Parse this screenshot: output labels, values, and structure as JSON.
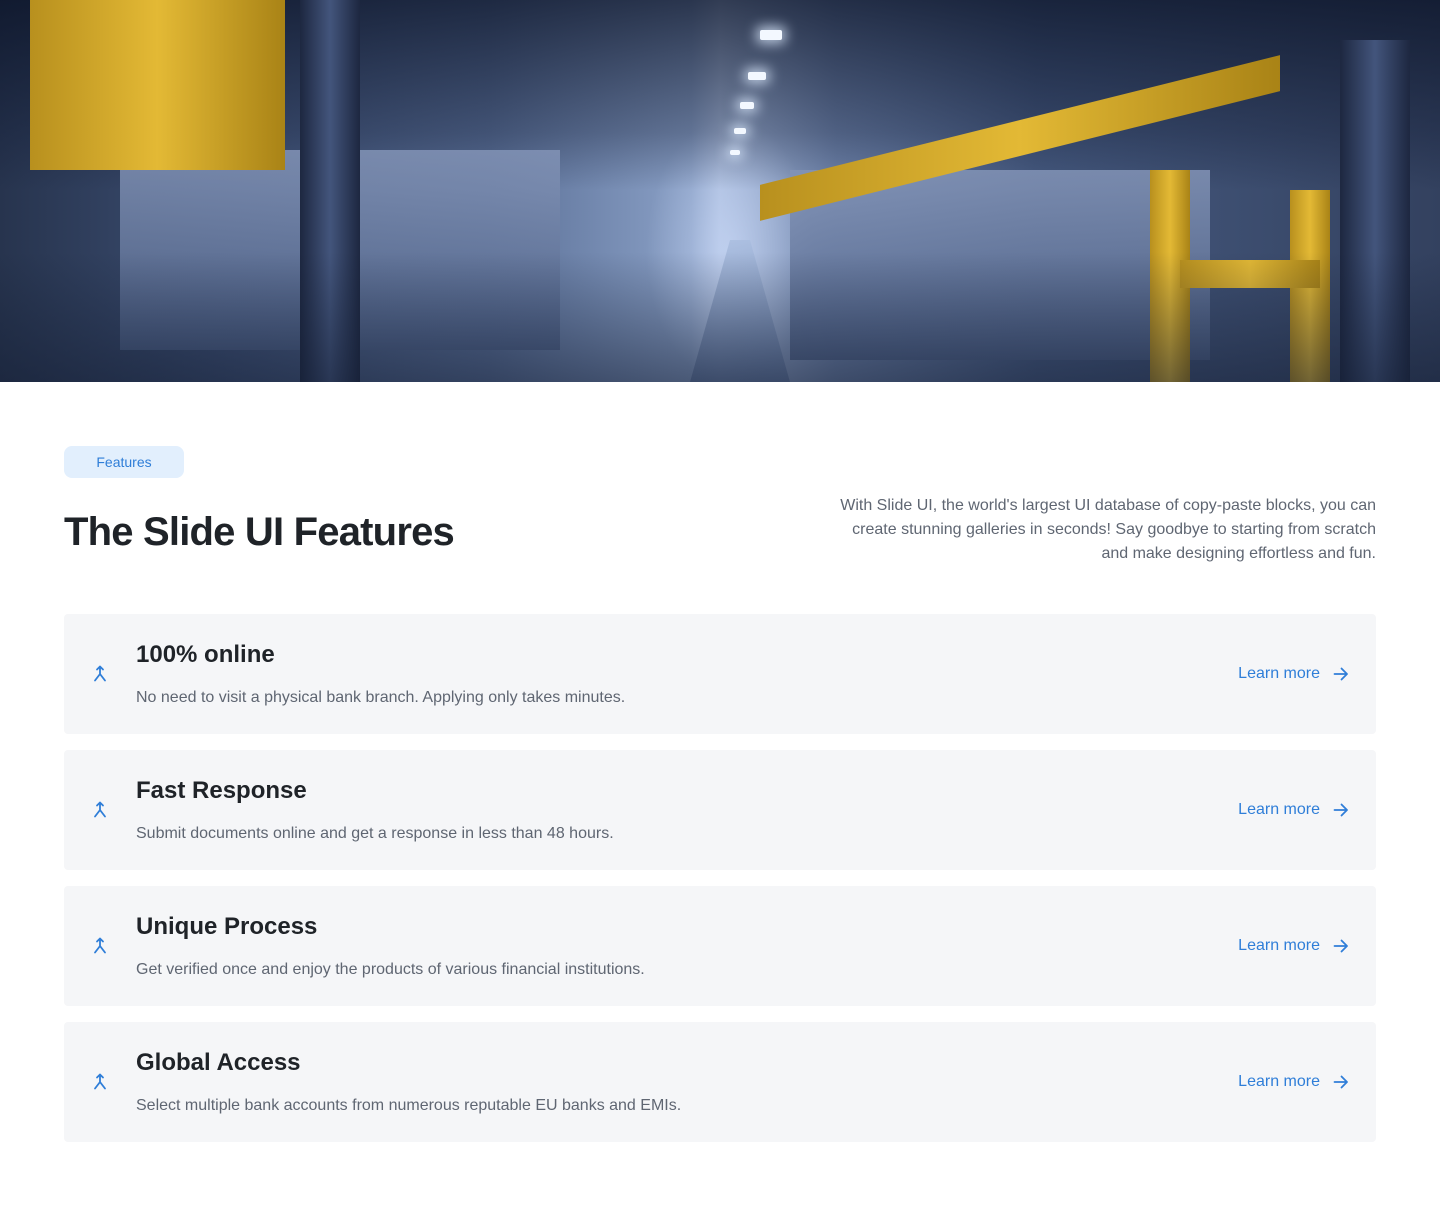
{
  "hero": {
    "image_alt": "Industrial factory production line with yellow overhead machinery"
  },
  "section": {
    "badge": "Features",
    "title": "The Slide UI Features",
    "description": "With Slide UI, the world's largest UI database of copy-paste blocks, you can create stunning galleries in seconds! Say goodbye to starting from scratch and make designing effortless and fun."
  },
  "features": [
    {
      "title": "100% online",
      "text": "No need to visit a physical bank branch. Applying only takes minutes.",
      "link": "Learn more",
      "icon": "merge-arrow-icon"
    },
    {
      "title": "Fast Response",
      "text": "Submit documents online and get a response in less than 48 hours.",
      "link": "Learn more",
      "icon": "merge-arrow-icon"
    },
    {
      "title": "Unique Process",
      "text": "Get verified once and enjoy the products of various financial institutions.",
      "link": "Learn more",
      "icon": "merge-arrow-icon"
    },
    {
      "title": "Global Access",
      "text": "Select multiple bank accounts from numerous reputable EU banks and EMIs.",
      "link": "Learn more",
      "icon": "merge-arrow-icon"
    }
  ],
  "colors": {
    "accent": "#2f7ed8",
    "badge_bg": "#e2effd",
    "card_bg": "#f5f6f8",
    "heading": "#1f2328",
    "body_text": "#5f6672"
  }
}
